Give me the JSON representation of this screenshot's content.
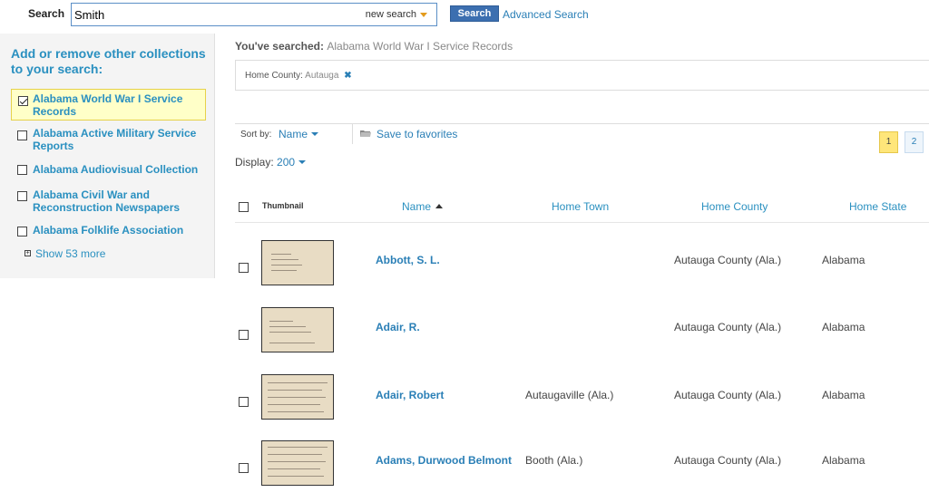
{
  "search": {
    "label": "Search",
    "value": "Smith",
    "mode_label": "new search",
    "button_label": "Search",
    "advanced_label": "Advanced Search"
  },
  "sidebar": {
    "title": "Add or remove other collections to your search:",
    "collections": [
      {
        "label": "Alabama World War I Service Records",
        "checked": true
      },
      {
        "label": "Alabama Active Military Service Reports",
        "checked": false
      },
      {
        "label": "Alabama Audiovisual Collection",
        "checked": false
      },
      {
        "label": "Alabama Civil War and Reconstruction Newspapers",
        "checked": false
      },
      {
        "label": "Alabama Folklife Association",
        "checked": false
      }
    ],
    "show_more": "Show 53 more"
  },
  "searched": {
    "prefix": "You've searched:",
    "query": "Alabama World War I Service Records"
  },
  "facet": {
    "field": "Home County:",
    "value": "Autauga",
    "remove": "✖"
  },
  "sort": {
    "label": "Sort by:",
    "value": "Name",
    "favorites": "Save to favorites"
  },
  "pagination": {
    "pages": [
      "1",
      "2"
    ],
    "current": "1"
  },
  "display": {
    "label": "Display:",
    "value": "200"
  },
  "table": {
    "headers": {
      "thumbnail": "Thumbnail",
      "name": "Name",
      "town": "Home Town",
      "county": "Home County",
      "state": "Home State"
    },
    "rows": [
      {
        "name": "Abbott, S. L.",
        "town": "",
        "county": "Autauga County (Ala.)",
        "state": "Alabama"
      },
      {
        "name": "Adair, R.",
        "town": "",
        "county": "Autauga County (Ala.)",
        "state": "Alabama"
      },
      {
        "name": "Adair, Robert",
        "town": "Autaugaville (Ala.)",
        "county": "Autauga County (Ala.)",
        "state": "Alabama"
      },
      {
        "name": "Adams, Durwood Belmont",
        "town": "Booth (Ala.)",
        "county": "Autauga County (Ala.)",
        "state": "Alabama"
      }
    ]
  },
  "colors": {
    "link": "#2a7fb6",
    "sidebar_title": "#2a90c0",
    "search_button": "#3c6fb0",
    "highlight": "#ffffc8",
    "page_current": "#ffe67a"
  }
}
